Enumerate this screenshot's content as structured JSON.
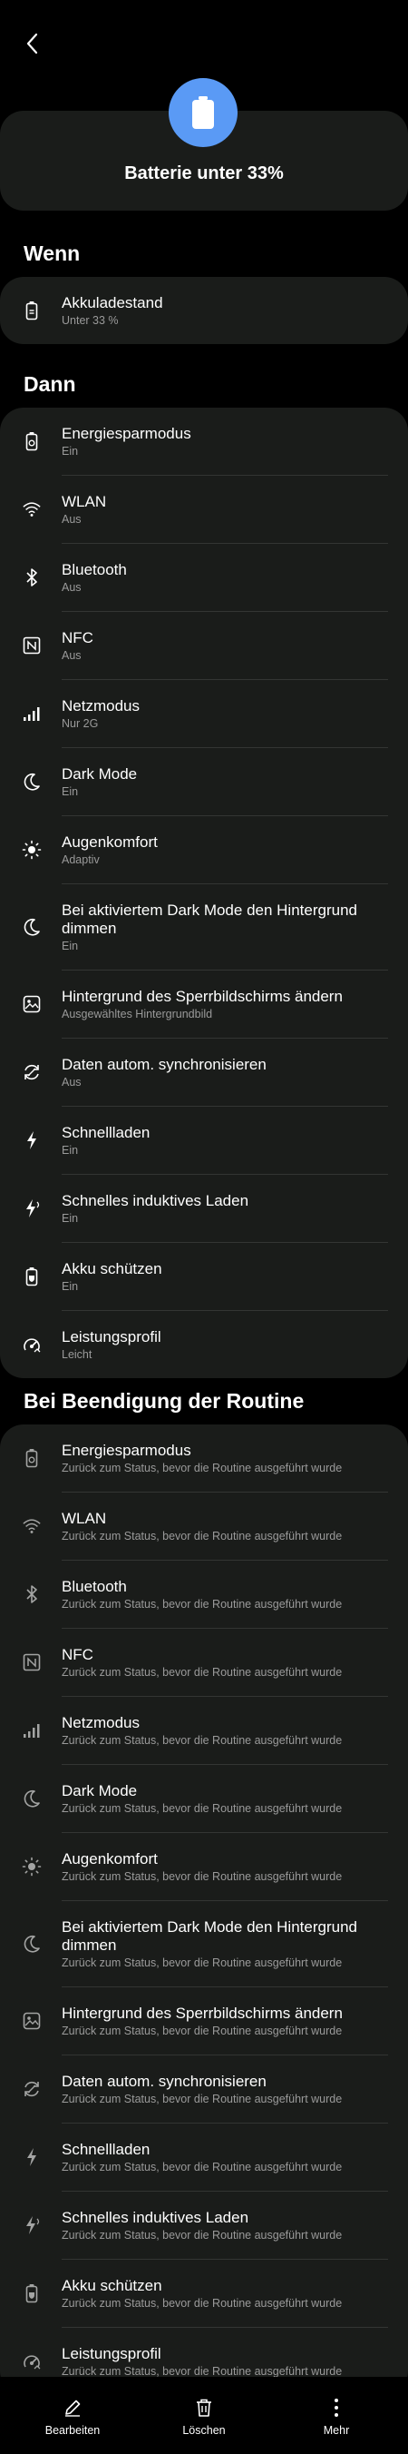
{
  "header": {
    "back_icon": "chevron-left-icon"
  },
  "hero": {
    "title": "Batterie unter 33%",
    "icon": "battery-icon",
    "icon_color": "#5a9af5"
  },
  "sections": {
    "wenn": "Wenn",
    "dann": "Dann",
    "ende": "Bei Beendigung der Routine"
  },
  "wenn": {
    "items": [
      {
        "title": "Akkuladestand",
        "sub": "Unter 33 %",
        "icon": "battery-icon"
      }
    ]
  },
  "dann": {
    "items": [
      {
        "title": "Energiesparmodus",
        "sub": "Ein",
        "icon": "power-saving-icon"
      },
      {
        "title": "WLAN",
        "sub": "Aus",
        "icon": "wifi-icon"
      },
      {
        "title": "Bluetooth",
        "sub": "Aus",
        "icon": "bluetooth-icon"
      },
      {
        "title": "NFC",
        "sub": "Aus",
        "icon": "nfc-icon"
      },
      {
        "title": "Netzmodus",
        "sub": "Nur 2G",
        "icon": "signal-icon"
      },
      {
        "title": "Dark Mode",
        "sub": "Ein",
        "icon": "moon-icon"
      },
      {
        "title": "Augenkomfort",
        "sub": "Adaptiv",
        "icon": "sun-icon"
      },
      {
        "title": "Bei aktiviertem Dark Mode den Hintergrund dimmen",
        "sub": "Ein",
        "icon": "moon-icon"
      },
      {
        "title": "Hintergrund des Sperrbildschirms ändern",
        "sub": "Ausgewähltes Hintergrundbild",
        "icon": "wallpaper-icon"
      },
      {
        "title": "Daten autom. synchronisieren",
        "sub": "Aus",
        "icon": "sync-icon"
      },
      {
        "title": "Schnellladen",
        "sub": "Ein",
        "icon": "fast-charge-icon"
      },
      {
        "title": "Schnelles induktives Laden",
        "sub": "Ein",
        "icon": "wireless-charge-icon"
      },
      {
        "title": "Akku schützen",
        "sub": "Ein",
        "icon": "battery-protect-icon"
      },
      {
        "title": "Leistungsprofil",
        "sub": "Leicht",
        "icon": "performance-icon"
      }
    ]
  },
  "ende": {
    "items": [
      {
        "title": "Energiesparmodus",
        "sub": "Zurück zum Status, bevor die Routine ausgeführt wurde",
        "icon": "power-saving-icon"
      },
      {
        "title": "WLAN",
        "sub": "Zurück zum Status, bevor die Routine ausgeführt wurde",
        "icon": "wifi-icon"
      },
      {
        "title": "Bluetooth",
        "sub": "Zurück zum Status, bevor die Routine ausgeführt wurde",
        "icon": "bluetooth-icon"
      },
      {
        "title": "NFC",
        "sub": "Zurück zum Status, bevor die Routine ausgeführt wurde",
        "icon": "nfc-icon"
      },
      {
        "title": "Netzmodus",
        "sub": "Zurück zum Status, bevor die Routine ausgeführt wurde",
        "icon": "signal-icon"
      },
      {
        "title": "Dark Mode",
        "sub": "Zurück zum Status, bevor die Routine ausgeführt wurde",
        "icon": "moon-icon"
      },
      {
        "title": "Augenkomfort",
        "sub": "Zurück zum Status, bevor die Routine ausgeführt wurde",
        "icon": "sun-icon"
      },
      {
        "title": "Bei aktiviertem Dark Mode den Hintergrund dimmen",
        "sub": "Zurück zum Status, bevor die Routine ausgeführt wurde",
        "icon": "moon-icon"
      },
      {
        "title": "Hintergrund des Sperrbildschirms ändern",
        "sub": "Zurück zum Status, bevor die Routine ausgeführt wurde",
        "icon": "wallpaper-icon"
      },
      {
        "title": "Daten autom. synchronisieren",
        "sub": "Zurück zum Status, bevor die Routine ausgeführt wurde",
        "icon": "sync-icon"
      },
      {
        "title": "Schnellladen",
        "sub": "Zurück zum Status, bevor die Routine ausgeführt wurde",
        "icon": "fast-charge-icon"
      },
      {
        "title": "Schnelles induktives Laden",
        "sub": "Zurück zum Status, bevor die Routine ausgeführt wurde",
        "icon": "wireless-charge-icon"
      },
      {
        "title": "Akku schützen",
        "sub": "Zurück zum Status, bevor die Routine ausgeführt wurde",
        "icon": "battery-protect-icon"
      },
      {
        "title": "Leistungsprofil",
        "sub": "Zurück zum Status, bevor die Routine ausgeführt wurde",
        "icon": "performance-icon"
      }
    ]
  },
  "bottom_bar": {
    "edit": {
      "label": "Bearbeiten",
      "icon": "pencil-icon"
    },
    "delete": {
      "label": "Löschen",
      "icon": "trash-icon"
    },
    "more": {
      "label": "Mehr",
      "icon": "more-vertical-icon"
    }
  }
}
